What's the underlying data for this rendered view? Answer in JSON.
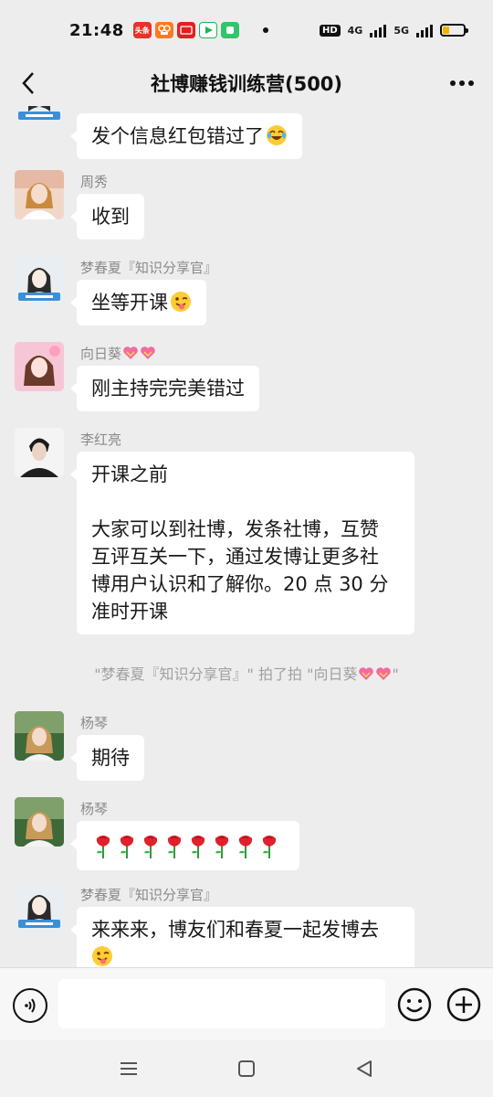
{
  "status_bar": {
    "time": "21:48",
    "app_icons": [
      {
        "name": "toutiao-icon",
        "label": "头条",
        "color": "#e8322b"
      },
      {
        "name": "kuaishou-icon",
        "label": "",
        "color": "#ff7a1a"
      },
      {
        "name": "app-icon",
        "label": "",
        "color": "#e0211f"
      },
      {
        "name": "video-app-icon",
        "label": "",
        "color": "#1fb35b"
      },
      {
        "name": "green-app-icon",
        "label": "",
        "color": "#32c46a"
      }
    ],
    "hd": "HD",
    "net1": "4G",
    "net2": "5G"
  },
  "nav": {
    "title": "社博赚钱训练营(500)"
  },
  "messages": [
    {
      "sender": "",
      "lines": [
        "发个信息红包错过了"
      ],
      "emoji": "laugh-cry-emoji"
    },
    {
      "sender": "周秀",
      "lines": [
        "收到"
      ]
    },
    {
      "sender": "梦春夏『知识分享官』",
      "lines": [
        "坐等开课"
      ],
      "emoji": "wink-tongue-emoji"
    },
    {
      "sender": "向日葵",
      "lines": [
        "刚主持完完美错过"
      ]
    },
    {
      "sender": "李红亮",
      "lines": [
        "开课之前",
        "",
        "大家可以到社博，发条社博，互赞",
        "互评互关一下，通过发博让更多社",
        "博用户认识和了解你。20 点 30 分",
        "准时开课"
      ]
    },
    {
      "sender": "杨琴",
      "lines": [
        "期待"
      ]
    },
    {
      "sender": "杨琴",
      "lines": [],
      "roses": 8
    },
    {
      "sender": "梦春夏『知识分享官』",
      "lines": [
        "来来来，博友们和春夏一起发博去"
      ],
      "emoji": "wink-tongue-emoji"
    }
  ],
  "system_note": {
    "prefix": "\"梦春夏『知识分享官』\" 拍了拍 \"向日葵",
    "suffix": "\""
  },
  "input": {
    "placeholder": "",
    "value": ""
  },
  "colors": {
    "background": "#ededed",
    "bubble": "#ffffff",
    "sender_text": "#8a8a8a",
    "heart_pink": "#f46aa0"
  }
}
